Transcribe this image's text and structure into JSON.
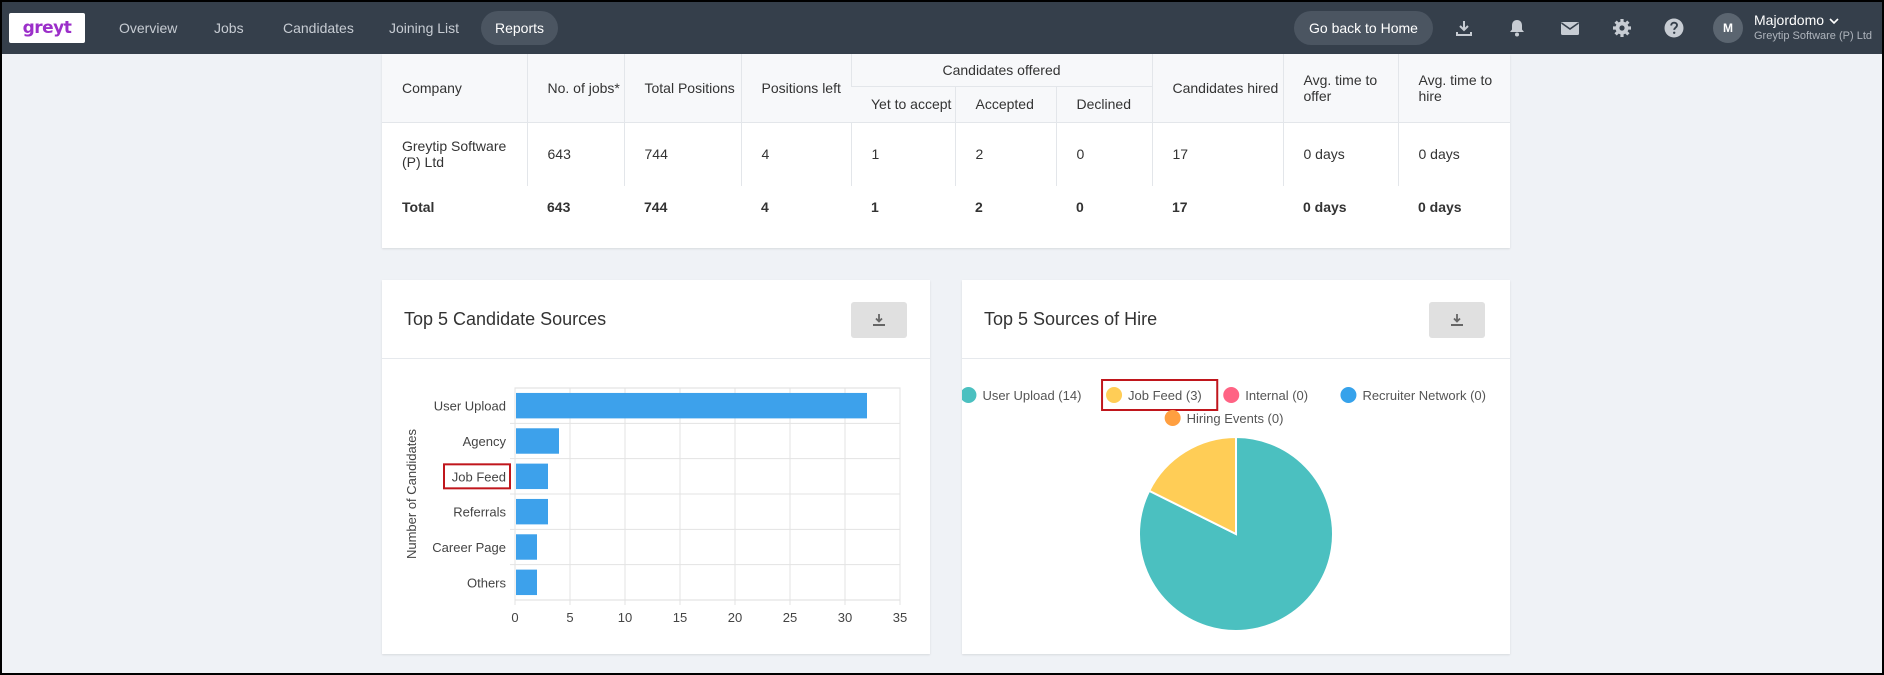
{
  "nav": {
    "logo": "greyt",
    "items": [
      "Overview",
      "Jobs",
      "Candidates",
      "Joining List",
      "Reports"
    ],
    "active": "Reports",
    "home_button": "Go back to Home",
    "icons": [
      "download-icon",
      "bell-icon",
      "mail-icon",
      "gear-icon",
      "help-icon"
    ],
    "user": {
      "initial": "M",
      "name": "Majordomo",
      "company": "Greytip Software (P) Ltd"
    }
  },
  "table": {
    "headers": {
      "company": "Company",
      "jobs": "No. of jobs*",
      "total_positions": "Total Positions",
      "positions_left": "Positions left",
      "offered_group": "Candidates offered",
      "yet_to_accept": "Yet to accept",
      "accepted": "Accepted",
      "declined": "Declined",
      "hired": "Candidates hired",
      "avg_offer": "Avg. time to offer",
      "avg_hire": "Avg. time to hire"
    },
    "rows": [
      [
        "Greytip Software (P) Ltd",
        "643",
        "744",
        "4",
        "1",
        "2",
        "0",
        "17",
        "0 days",
        "0 days"
      ]
    ],
    "total": [
      "Total",
      "643",
      "744",
      "4",
      "1",
      "2",
      "0",
      "17",
      "0 days",
      "0 days"
    ]
  },
  "candidate_sources": {
    "title": "Top 5 Candidate Sources",
    "download_icon": "download-icon",
    "highlighted": "Job Feed"
  },
  "sources_of_hire": {
    "title": "Top 5 Sources of Hire",
    "download_icon": "download-icon",
    "legend": [
      {
        "label": "User Upload (14)",
        "color": "#4bc0c0"
      },
      {
        "label": "Job Feed (3)",
        "color": "#ffcd56"
      },
      {
        "label": "Internal (0)",
        "color": "#ff6384"
      },
      {
        "label": "Recruiter Network (0)",
        "color": "#36a2eb"
      },
      {
        "label": "Hiring Events (0)",
        "color": "#ff9f40"
      }
    ],
    "highlighted": "Job Feed (3)"
  },
  "chart_data": [
    {
      "type": "bar",
      "orientation": "horizontal",
      "title": "Top 5 Candidate Sources",
      "categories": [
        "User Upload",
        "Agency",
        "Job Feed",
        "Referrals",
        "Career Page",
        "Others"
      ],
      "values": [
        32,
        4,
        3,
        3,
        2,
        2
      ],
      "ylabel": "Number of Candidates",
      "xlim": [
        0,
        35
      ],
      "xticks": [
        0,
        5,
        10,
        15,
        20,
        25,
        30,
        35
      ],
      "color": "#3da1eb",
      "grid": true
    },
    {
      "type": "pie",
      "title": "Top 5 Sources of Hire",
      "categories": [
        "User Upload",
        "Job Feed",
        "Internal",
        "Recruiter Network",
        "Hiring Events"
      ],
      "values": [
        14,
        3,
        0,
        0,
        0
      ],
      "colors": [
        "#4bc0c0",
        "#ffcd56",
        "#ff6384",
        "#36a2eb",
        "#ff9f40"
      ],
      "legend": "top"
    }
  ]
}
